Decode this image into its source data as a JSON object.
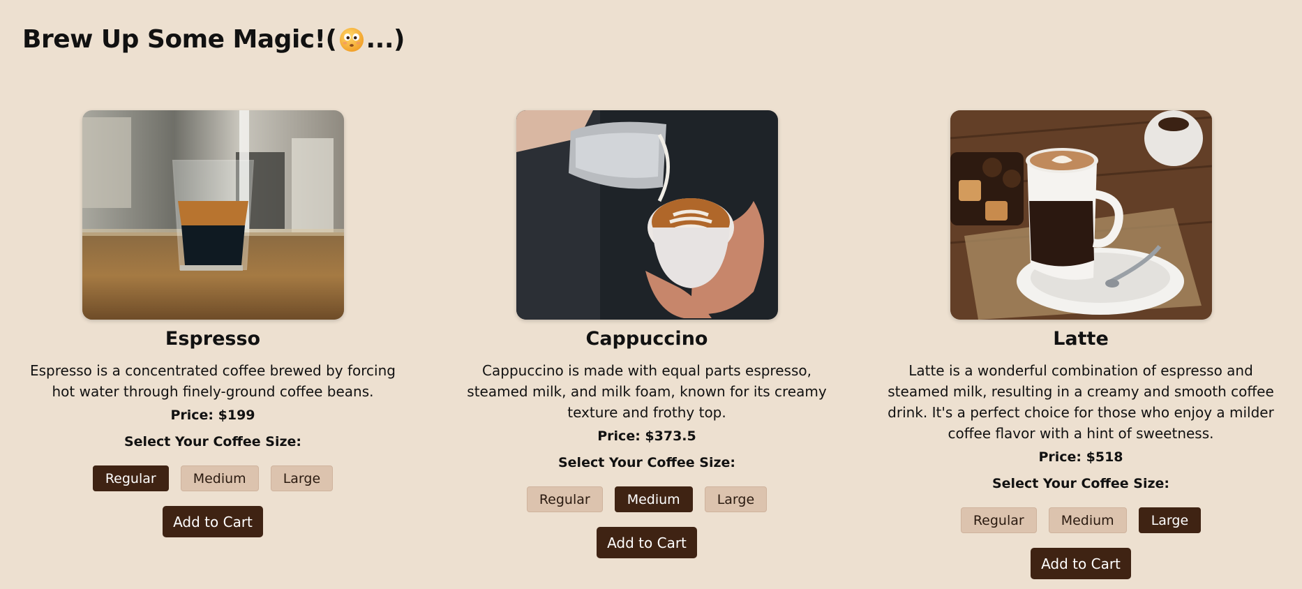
{
  "header": {
    "title_prefix": "Brew Up Some Magic!(",
    "title_suffix": "...)",
    "emoji_icon": "flushed-face-emoji"
  },
  "theme": {
    "background": "#ede0d0",
    "button_dark": "#3f2313",
    "button_light": "#dcc3ae"
  },
  "products": [
    {
      "name": "Espresso",
      "description": "Espresso is a concentrated coffee brewed by forcing hot water through finely-ground coffee beans.",
      "price": "Price: $199",
      "size_label": "Select Your Coffee Size:",
      "sizes": [
        "Regular",
        "Medium",
        "Large"
      ],
      "selected_size": "Regular",
      "cta": "Add to Cart"
    },
    {
      "name": "Cappuccino",
      "description": "Cappuccino is made with equal parts espresso, steamed milk, and milk foam, known for its creamy texture and frothy top.",
      "price": "Price: $373.5",
      "size_label": "Select Your Coffee Size:",
      "sizes": [
        "Regular",
        "Medium",
        "Large"
      ],
      "selected_size": "Medium",
      "cta": "Add to Cart"
    },
    {
      "name": "Latte",
      "description": "Latte is a wonderful combination of espresso and steamed milk, resulting in a creamy and smooth coffee drink. It's a perfect choice for those who enjoy a milder coffee flavor with a hint of sweetness.",
      "price": "Price: $518",
      "size_label": "Select Your Coffee Size:",
      "sizes": [
        "Regular",
        "Medium",
        "Large"
      ],
      "selected_size": "Large",
      "cta": "Add to Cart"
    }
  ]
}
